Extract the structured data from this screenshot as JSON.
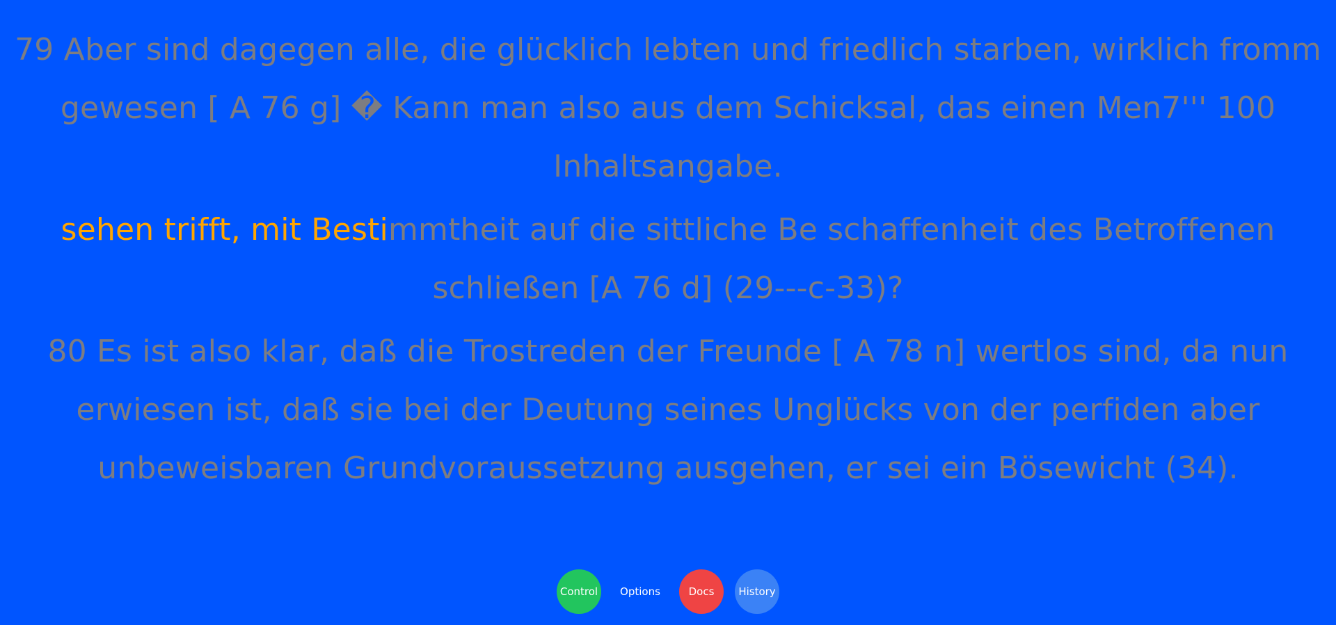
{
  "reader": {
    "paragraph1": "79 Aber sind dagegen alle, die glücklich lebten und friedlich starben, wirklich fromm gewesen [ A 76 g] � Kann man also aus dem Schicksal, das einen Men7''' 100 Inhaltsangabe.",
    "paragraph2_highlighted": "sehen trifft, mit Besti",
    "paragraph2_rest": "mmtheit auf die sittliche Be schaffenheit des Betroffenen schließen [A 76 d] (29---c-33)?",
    "paragraph3": "80 Es ist also klar, daß die Trostreden der Freunde [ A 78 n] wertlos sind, da nun erwiesen ist, daß sie bei der Deutung seines Unglücks von der perfiden aber unbeweisbaren Grundvoraussetzung ausgehen, er sei ein Bösewicht (34)."
  },
  "controls": {
    "control_label": "Control",
    "options_label": "Options",
    "docs_label": "Docs",
    "history_label": "History"
  },
  "colors": {
    "background": "#0055ff",
    "text": "#7d7d82",
    "highlight": "#ffa500",
    "control": "#22c55e",
    "docs": "#ef4444",
    "history": "#3b82f6"
  }
}
